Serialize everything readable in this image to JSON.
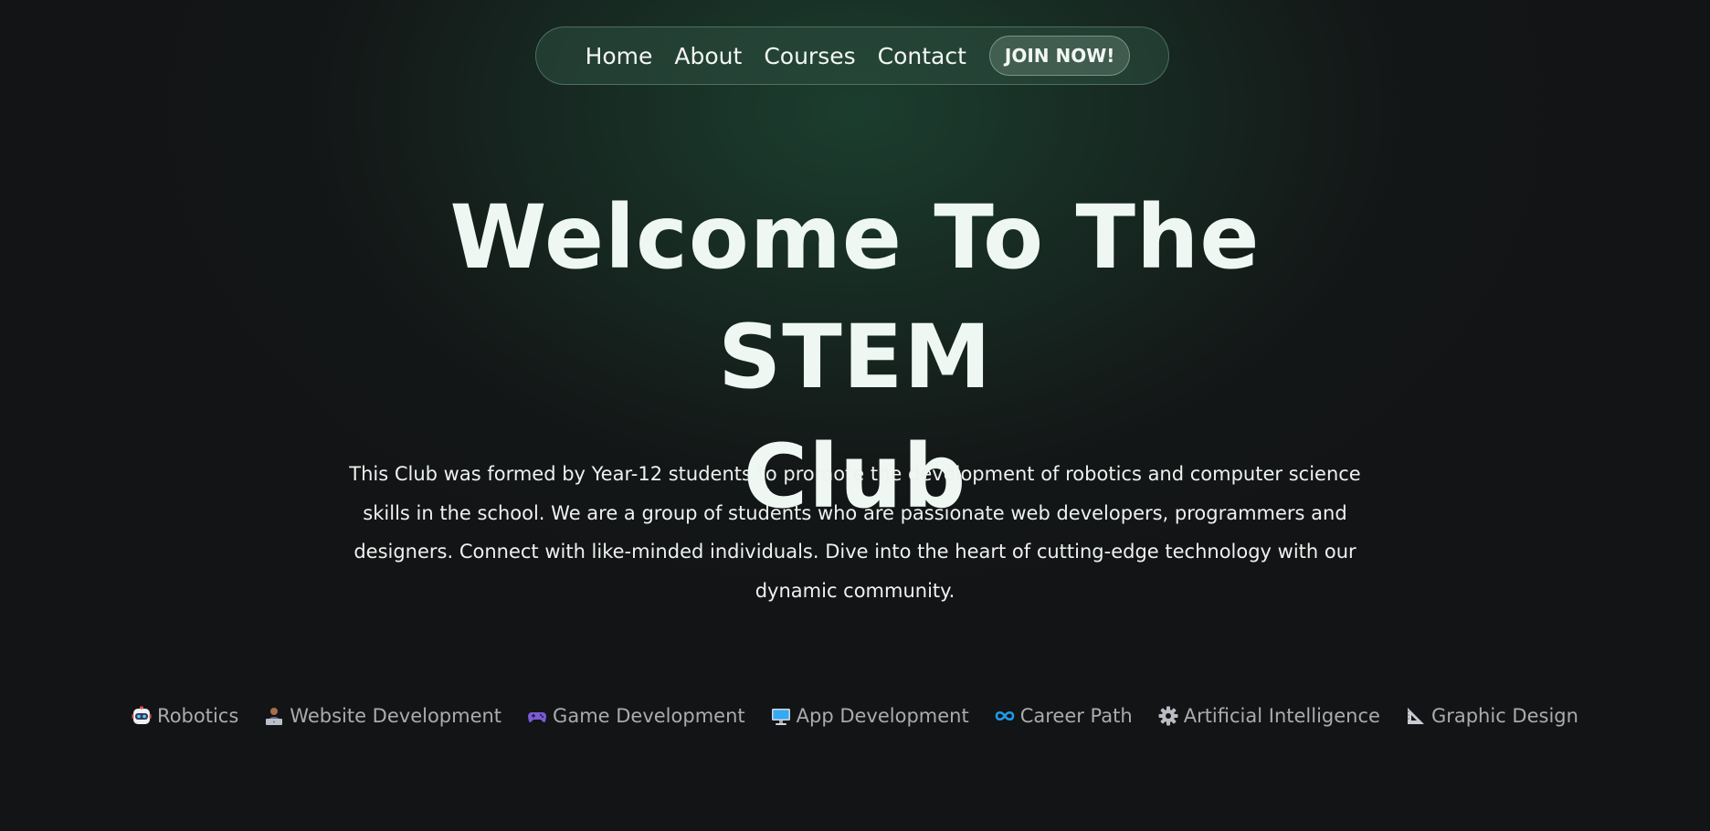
{
  "nav": {
    "links": [
      "Home",
      "About",
      "Courses",
      "Contact"
    ],
    "cta_label": "JOIN NOW!"
  },
  "hero": {
    "title_line1": "Welcome To The STEM",
    "title_line2": "Club",
    "description": "This Club was formed by Year-12 students to promote the development of robotics and computer science skills in the school. We are a group of students who are passionate web developers, programmers and designers. Connect with like-minded individuals. Dive into the heart of cutting-edge technology with our dynamic community."
  },
  "topics": [
    {
      "label": "Robotics",
      "icon": "robot-icon"
    },
    {
      "label": "Website Development",
      "icon": "technologist-icon"
    },
    {
      "label": "Game Development",
      "icon": "game-controller-icon"
    },
    {
      "label": "App Development",
      "icon": "computer-icon"
    },
    {
      "label": "Career Path",
      "icon": "infinity-icon"
    },
    {
      "label": "Artificial Intelligence",
      "icon": "gear-icon"
    },
    {
      "label": "Graphic Design",
      "icon": "triangular-ruler-icon"
    }
  ],
  "colors": {
    "background": "#131415",
    "hero_glow": "#1c4030",
    "text": "#eef6f1",
    "topic_text": "#a9acad",
    "career_icon": "#1e9be8"
  }
}
